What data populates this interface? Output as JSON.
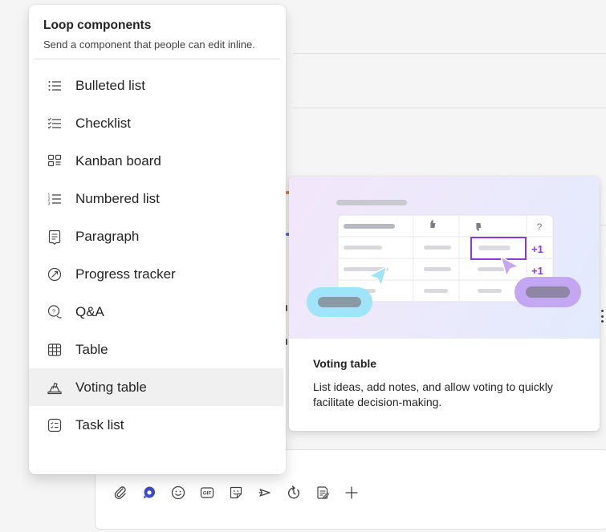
{
  "menu": {
    "title": "Loop components",
    "description": "Send a component that people can edit inline.",
    "items": [
      {
        "label": "Bulleted list",
        "icon": "bulleted-list-icon",
        "active": false
      },
      {
        "label": "Checklist",
        "icon": "checklist-icon",
        "active": false
      },
      {
        "label": "Kanban board",
        "icon": "kanban-board-icon",
        "active": false
      },
      {
        "label": "Numbered list",
        "icon": "numbered-list-icon",
        "active": false
      },
      {
        "label": "Paragraph",
        "icon": "paragraph-icon",
        "active": false
      },
      {
        "label": "Progress tracker",
        "icon": "progress-tracker-icon",
        "active": false
      },
      {
        "label": "Q&A",
        "icon": "qa-icon",
        "active": false
      },
      {
        "label": "Table",
        "icon": "table-icon",
        "active": false
      },
      {
        "label": "Voting table",
        "icon": "voting-table-icon",
        "active": true
      },
      {
        "label": "Task list",
        "icon": "task-list-icon",
        "active": false
      }
    ]
  },
  "preview": {
    "title": "Voting table",
    "description": "List ideas, add notes, and allow voting to quickly facilitate decision-making.",
    "illustration": {
      "vote_badges": [
        "+1",
        "+1"
      ],
      "question_mark": "?",
      "accent_purple": "#8a3ad8",
      "accent_blue": "#9fe4f8",
      "accent_lavender": "#c4a7f2"
    }
  },
  "toolbar": {
    "buttons": [
      {
        "icon": "attach-icon"
      },
      {
        "icon": "loop-icon"
      },
      {
        "icon": "emoji-icon"
      },
      {
        "icon": "gif-icon",
        "label": "GIF"
      },
      {
        "icon": "sticker-icon"
      },
      {
        "icon": "praise-icon"
      },
      {
        "icon": "schedule-icon"
      },
      {
        "icon": "approvals-icon"
      },
      {
        "icon": "add-icon"
      }
    ]
  },
  "colors": {
    "loop_brand": "#3b48c8",
    "menu_active_bg": "#f0f0f0"
  }
}
